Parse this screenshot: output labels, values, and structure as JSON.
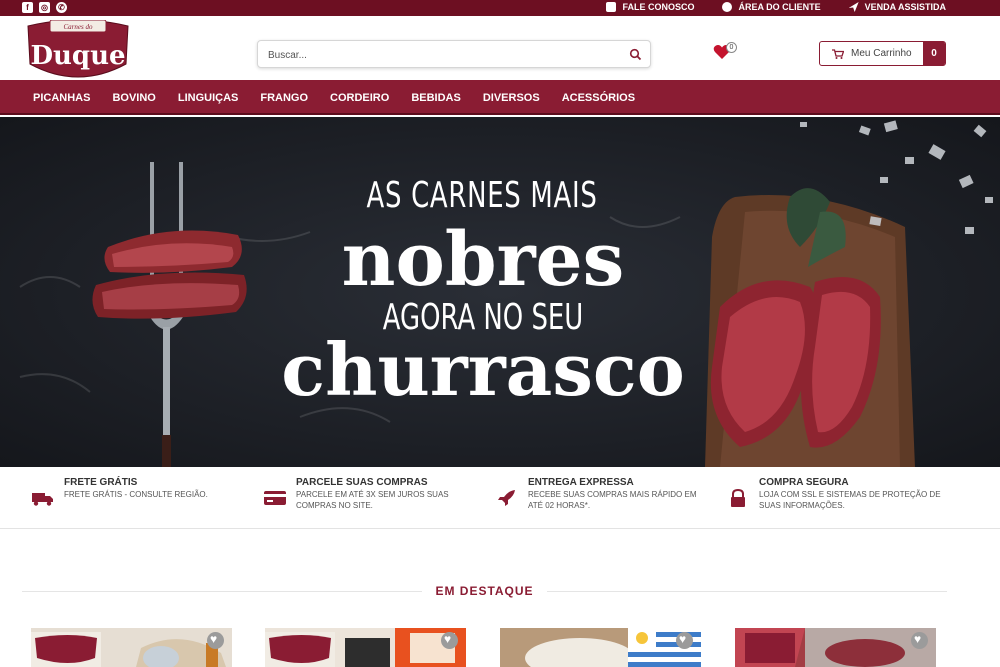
{
  "topbar": {
    "social": [
      "facebook-icon",
      "instagram-icon",
      "whatsapp-icon"
    ],
    "links": [
      {
        "label": "FALE CONOSCO",
        "icon": "phone-icon"
      },
      {
        "label": "ÁREA DO CLIENTE",
        "icon": "user-icon"
      },
      {
        "label": "VENDA ASSISTIDA",
        "icon": "plane-icon"
      }
    ]
  },
  "header": {
    "logo": {
      "top": "Carnes do",
      "name": "Duque"
    },
    "search": {
      "placeholder": "Buscar..."
    },
    "wishlist": {
      "count": "0"
    },
    "cart": {
      "label": "Meu Carrinho",
      "count": "0"
    }
  },
  "nav": [
    "PICANHAS",
    "BOVINO",
    "LINGUIÇAS",
    "FRANGO",
    "CORDEIRO",
    "BEBIDAS",
    "DIVERSOS",
    "ACESSÓRIOS"
  ],
  "hero": {
    "line1": "AS CARNES MAIS",
    "line2": "nobres",
    "line3": "AGORA NO SEU",
    "line4": "churrasco"
  },
  "features": [
    {
      "title": "FRETE GRÁTIS",
      "desc": "FRETE GRÁTIS - CONSULTE REGIÃO.",
      "icon": "truck-icon"
    },
    {
      "title": "PARCELE SUAS COMPRAS",
      "desc": "PARCELE EM ATÉ 3X SEM JUROS SUAS COMPRAS NO SITE.",
      "icon": "credit-card-icon"
    },
    {
      "title": "ENTREGA EXPRESSA",
      "desc": "RECEBE SUAS COMPRAS MAIS RÁPIDO EM ATÉ 02 HORAS*.",
      "icon": "rocket-icon"
    },
    {
      "title": "COMPRA SEGURA",
      "desc": "LOJA COM SSL E SISTEMAS DE PROTEÇÃO DE SUAS INFORMAÇÕES.",
      "icon": "lock-icon"
    }
  ],
  "section": {
    "title": "EM DESTAQUE"
  },
  "colors": {
    "brand": "#8a1c33",
    "topbar": "#6d0f22",
    "hero_bg": "#1d2027"
  }
}
